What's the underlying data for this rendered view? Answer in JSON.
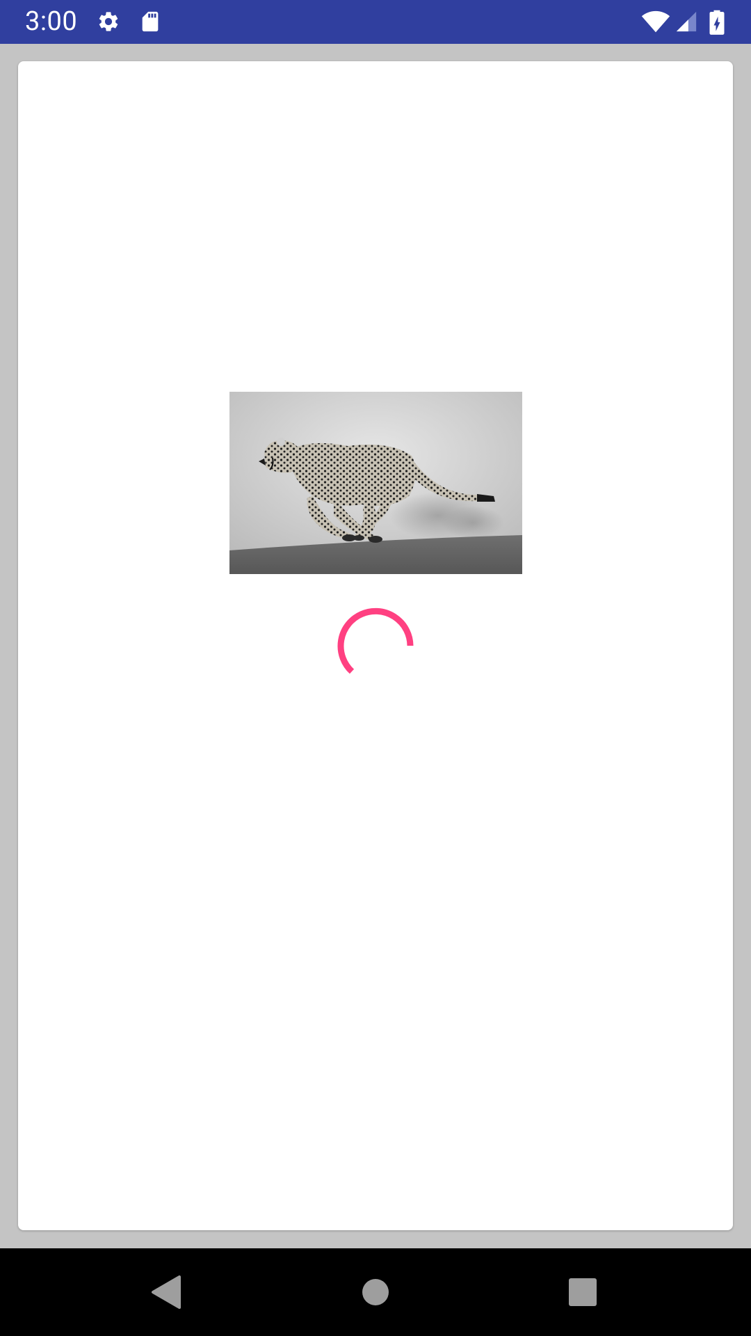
{
  "status_bar": {
    "time": "3:00",
    "background": "#303f9f",
    "icons": [
      "settings-icon",
      "sd-card-icon",
      "wifi-icon",
      "cell-signal-icon",
      "battery-charging-icon"
    ]
  },
  "content": {
    "card_background": "#ffffff",
    "image": {
      "subject": "running-cheetah-photo",
      "style": "black-and-white"
    },
    "loading_spinner": {
      "color": "#ff4081",
      "state": "loading"
    }
  },
  "navigation_bar": {
    "background": "#000000",
    "buttons": [
      "back-button",
      "home-button",
      "recents-button"
    ]
  }
}
